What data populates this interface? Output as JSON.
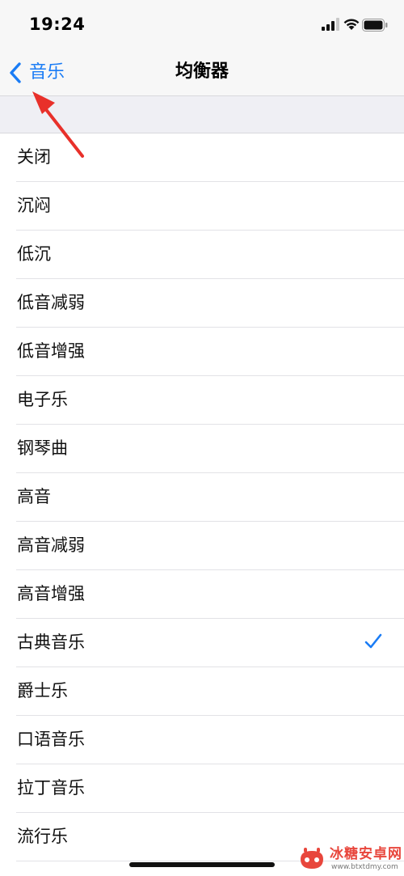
{
  "status_bar": {
    "time": "19:24"
  },
  "nav": {
    "back_label": "音乐",
    "title": "均衡器"
  },
  "equalizer": {
    "items": [
      {
        "label": "关闭",
        "selected": false
      },
      {
        "label": "沉闷",
        "selected": false
      },
      {
        "label": "低沉",
        "selected": false
      },
      {
        "label": "低音减弱",
        "selected": false
      },
      {
        "label": "低音增强",
        "selected": false
      },
      {
        "label": "电子乐",
        "selected": false
      },
      {
        "label": "钢琴曲",
        "selected": false
      },
      {
        "label": "高音",
        "selected": false
      },
      {
        "label": "高音减弱",
        "selected": false
      },
      {
        "label": "高音增强",
        "selected": false
      },
      {
        "label": "古典音乐",
        "selected": true
      },
      {
        "label": "爵士乐",
        "selected": false
      },
      {
        "label": "口语音乐",
        "selected": false
      },
      {
        "label": "拉丁音乐",
        "selected": false
      },
      {
        "label": "流行乐",
        "selected": false
      }
    ]
  },
  "colors": {
    "accent": "#1a7cf5",
    "annotation": "#e8302a",
    "background": "#efeff4"
  },
  "watermark": {
    "title": "冰糖安卓网",
    "url": "www.btxtdmy.com"
  }
}
